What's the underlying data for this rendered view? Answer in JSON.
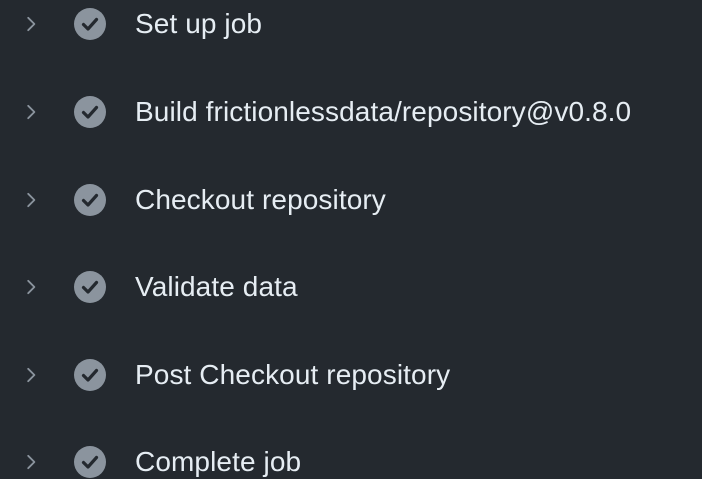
{
  "steps": [
    {
      "label": "Set up job",
      "icon": "chevron-right-icon",
      "status_icon": "check-circle-icon"
    },
    {
      "label": "Build frictionlessdata/repository@v0.8.0",
      "icon": "chevron-right-icon",
      "status_icon": "check-circle-icon"
    },
    {
      "label": "Checkout repository",
      "icon": "chevron-right-icon",
      "status_icon": "check-circle-icon"
    },
    {
      "label": "Validate data",
      "icon": "chevron-right-icon",
      "status_icon": "check-circle-icon"
    },
    {
      "label": "Post Checkout repository",
      "icon": "chevron-right-icon",
      "status_icon": "check-circle-icon"
    },
    {
      "label": "Complete job",
      "icon": "chevron-right-icon",
      "status_icon": "check-circle-icon"
    }
  ],
  "colors": {
    "background": "#24292f",
    "text": "#e6edf3",
    "chevron": "#8b949e",
    "check_circle": "#8b949e",
    "check_mark": "#24292f"
  }
}
